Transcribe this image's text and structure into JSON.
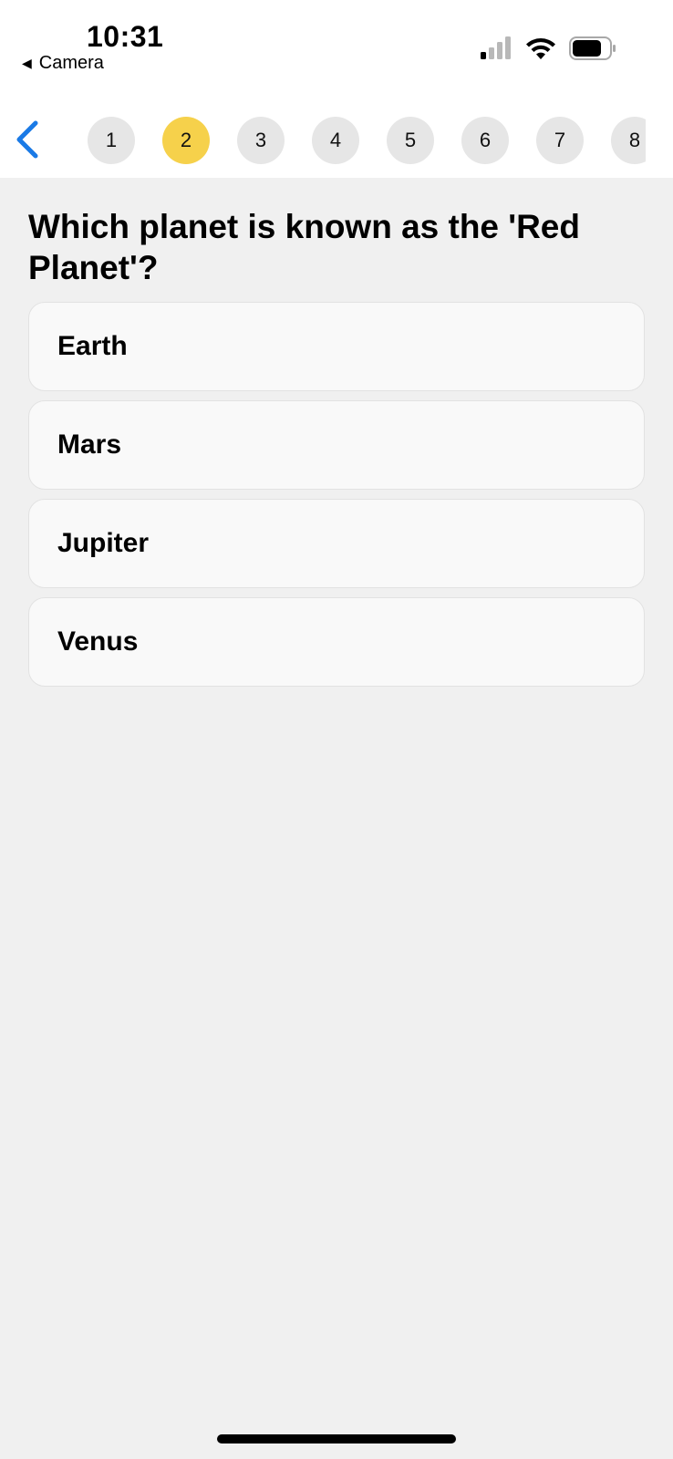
{
  "status_bar": {
    "time": "10:31",
    "back_app_label": "Camera",
    "back_arrow_glyph": "◀",
    "icons": [
      "cellular-signal-icon",
      "wifi-icon",
      "battery-icon"
    ]
  },
  "nav": {
    "back_icon": "chevron-left-icon",
    "accent_color": "#1a7ae6",
    "active_color": "#f6d14b",
    "questions": [
      "1",
      "2",
      "3",
      "4",
      "5",
      "6",
      "7",
      "8"
    ],
    "current_question": "2"
  },
  "quiz": {
    "question": "Which planet is known as the 'Red Planet'?",
    "options": [
      "Earth",
      "Mars",
      "Jupiter",
      "Venus"
    ]
  }
}
